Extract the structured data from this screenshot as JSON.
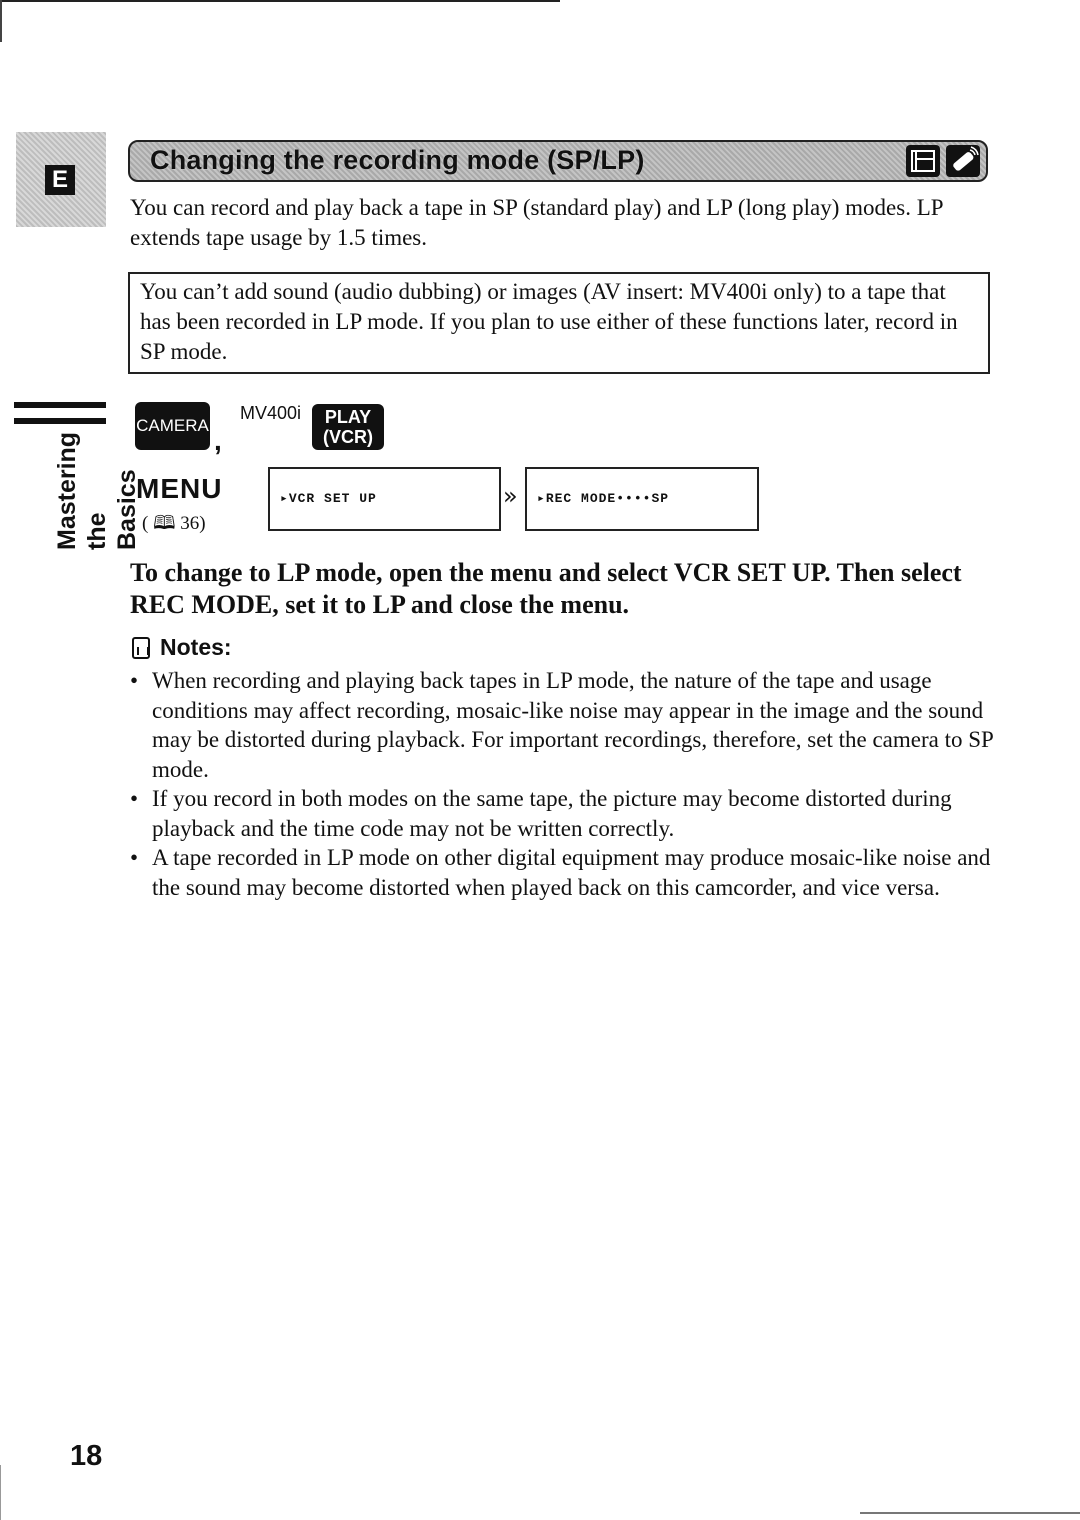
{
  "section_tab": {
    "letter": "E"
  },
  "header": {
    "title": "Changing the recording mode (SP/LP)",
    "icons": [
      "camcorder-mode-icon",
      "remote-control-icon"
    ]
  },
  "intro": "You can record and play back a tape in SP (standard play) and LP (long play) modes. LP extends tape usage by 1.5 times.",
  "notice": "You can’t add sound (audio dubbing) or images (AV insert: MV400i only) to a tape that has been recorded in LP mode. If you plan to use either of these functions later, record in SP mode.",
  "side_label": {
    "line1": "Mastering",
    "line2": "the Basics"
  },
  "mode_buttons": {
    "camera": "CAMERA",
    "separator": ",",
    "model_note": "MV400i",
    "play_line1": "PLAY",
    "play_line2": "(VCR)"
  },
  "menu": {
    "label": "MENU",
    "ref": "( 🕮 36)",
    "screen1": "▸VCR SET UP",
    "arrow": "»",
    "screen2": "▸REC MODE••••SP"
  },
  "instruction": "To change to LP mode, open the menu and select VCR SET UP. Then select REC MODE, set it to LP and close the menu.",
  "notes": {
    "heading": "Notes:",
    "items": [
      "When recording and playing back tapes in LP mode, the nature of the tape and usage conditions may affect recording, mosaic-like noise may appear in the image and the sound may be distorted during playback. For important recordings, therefore, set the camera to SP mode.",
      "If you record in both modes on the same tape, the picture may become distorted during playback and the time code may not be written correctly.",
      "A tape recorded in LP mode on other digital equipment may produce mosaic-like noise and the sound may become distorted when played back on this camcorder, and vice versa."
    ]
  },
  "page_number": "18"
}
